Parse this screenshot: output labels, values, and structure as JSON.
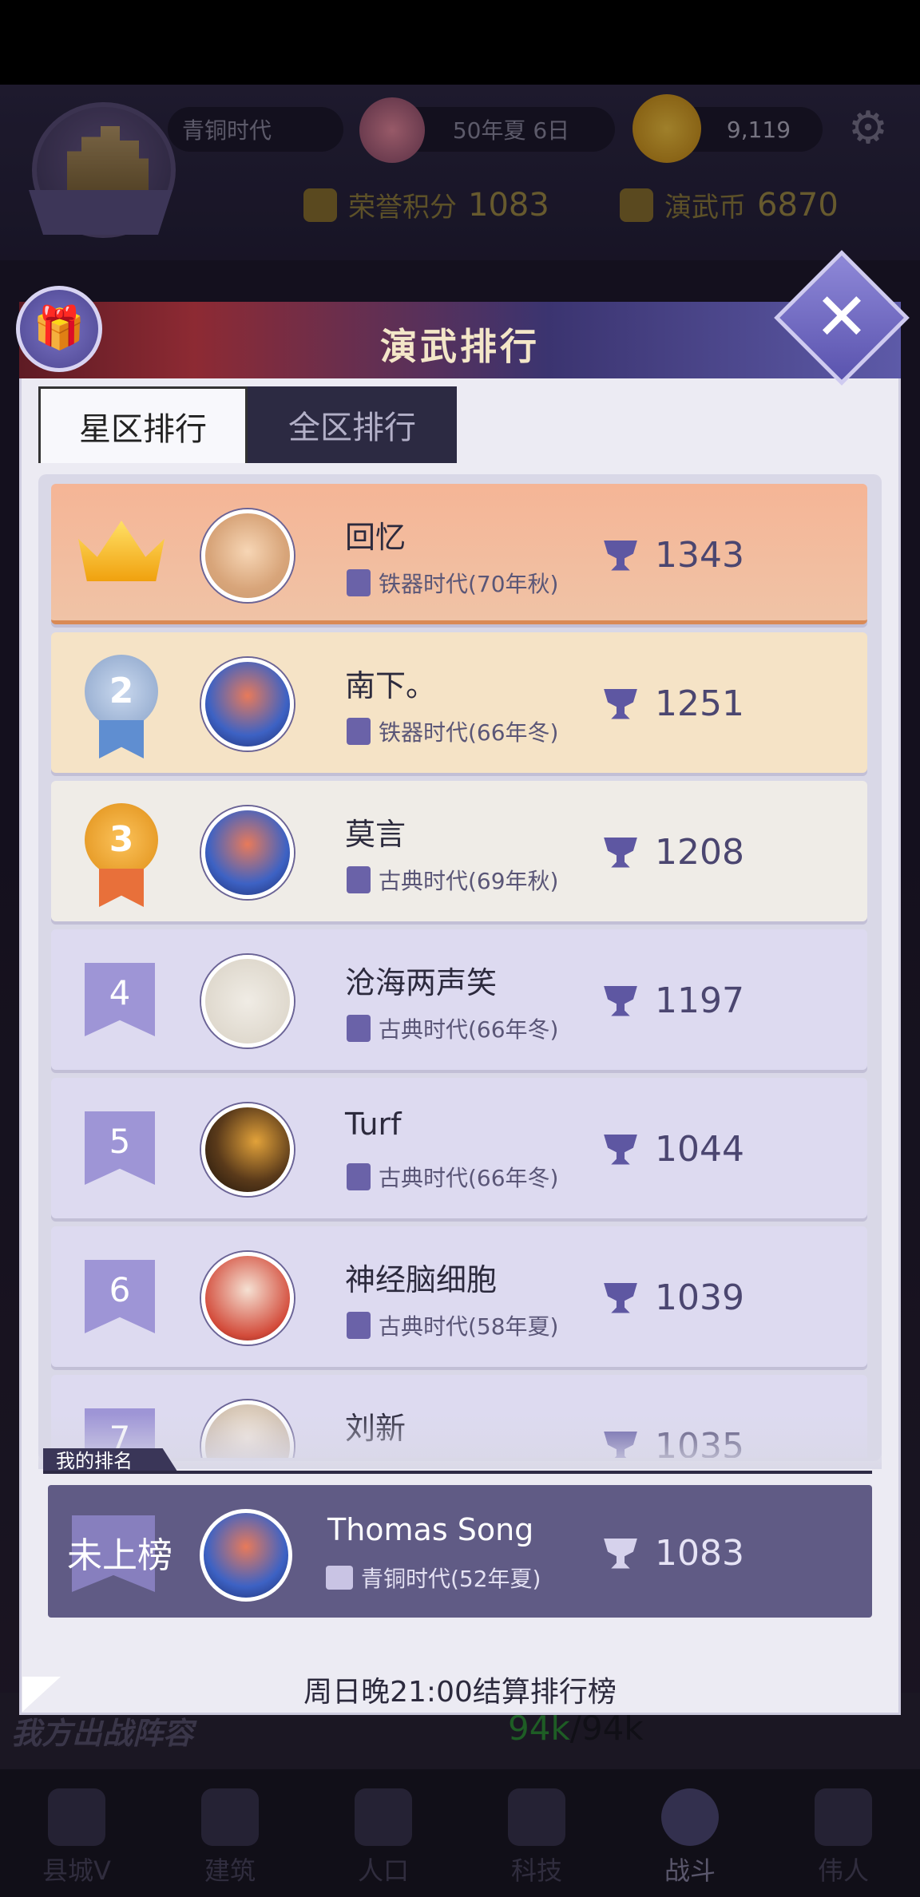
{
  "hud": {
    "era": "青铜时代",
    "date": "50年夏 6日",
    "gold": "9,119",
    "honor_label": "荣誉积分",
    "honor_value": "1083",
    "coin_label": "演武币",
    "coin_value": "6870"
  },
  "modal": {
    "title": "演武排行",
    "tabs": [
      {
        "label": "星区排行",
        "active": true
      },
      {
        "label": "全区排行",
        "active": false
      }
    ],
    "rows": [
      {
        "rank": "1",
        "name": "回忆",
        "era": "铁器时代(70年秋)",
        "score": "1343"
      },
      {
        "rank": "2",
        "name": "南下。",
        "era": "铁器时代(66年冬)",
        "score": "1251"
      },
      {
        "rank": "3",
        "name": "莫言",
        "era": "古典时代(69年秋)",
        "score": "1208"
      },
      {
        "rank": "4",
        "name": "沧海两声笑",
        "era": "古典时代(66年冬)",
        "score": "1197"
      },
      {
        "rank": "5",
        "name": "Turf",
        "era": "古典时代(66年冬)",
        "score": "1044"
      },
      {
        "rank": "6",
        "name": "神经脑细胞",
        "era": "古典时代(58年夏)",
        "score": "1039"
      },
      {
        "rank": "7",
        "name": "刘新",
        "era": "",
        "score": "1035"
      }
    ],
    "my_label": "我的排名",
    "my_row": {
      "rank": "未上榜",
      "name": "Thomas Song",
      "era": "青铜时代(52年夏)",
      "score": "1083"
    },
    "footer": "周日晚21:00结算排行榜"
  },
  "lineup": {
    "label": "我方出战阵容",
    "power_current": "94k",
    "power_sep": "/",
    "power_max": "94k"
  },
  "nav": [
    {
      "label": "县城V",
      "icon": "castle-icon"
    },
    {
      "label": "建筑",
      "icon": "house-icon"
    },
    {
      "label": "人口",
      "icon": "person-icon"
    },
    {
      "label": "科技",
      "icon": "book-icon"
    },
    {
      "label": "战斗",
      "icon": "swords-icon",
      "active": true
    },
    {
      "label": "伟人",
      "icon": "statue-icon"
    }
  ]
}
